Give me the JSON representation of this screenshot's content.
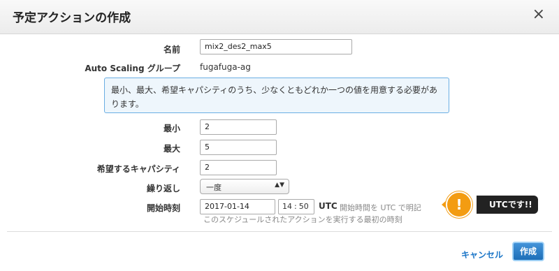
{
  "dialog": {
    "title": "予定アクションの作成",
    "close": "×"
  },
  "form": {
    "name_label": "名前",
    "name_value": "mix2_des2_max5",
    "asg_label": "Auto Scaling グループ",
    "asg_value": "fugafuga-ag",
    "info": "最小、最大、希望キャパシティのうち、少なくともどれか一つの値を用意する必要があります。",
    "min_label": "最小",
    "min_value": "2",
    "max_label": "最大",
    "max_value": "5",
    "desired_label": "希望するキャパシティ",
    "desired_value": "2",
    "recurrence_label": "繰り返し",
    "recurrence_value": "一度",
    "start_label": "開始時刻",
    "start_date": "2017-01-14",
    "start_hour": "14",
    "start_minute": "50",
    "tz": "UTC",
    "tz_hint": "開始時間を UTC で明記",
    "start_hint": "このスケジュールされたアクションを実行する最初の時刻"
  },
  "callout": {
    "text": "UTCです!!",
    "icon": "exclamation-icon",
    "color": "#f39c12"
  },
  "footer": {
    "cancel": "キャンセル",
    "create": "作成"
  }
}
